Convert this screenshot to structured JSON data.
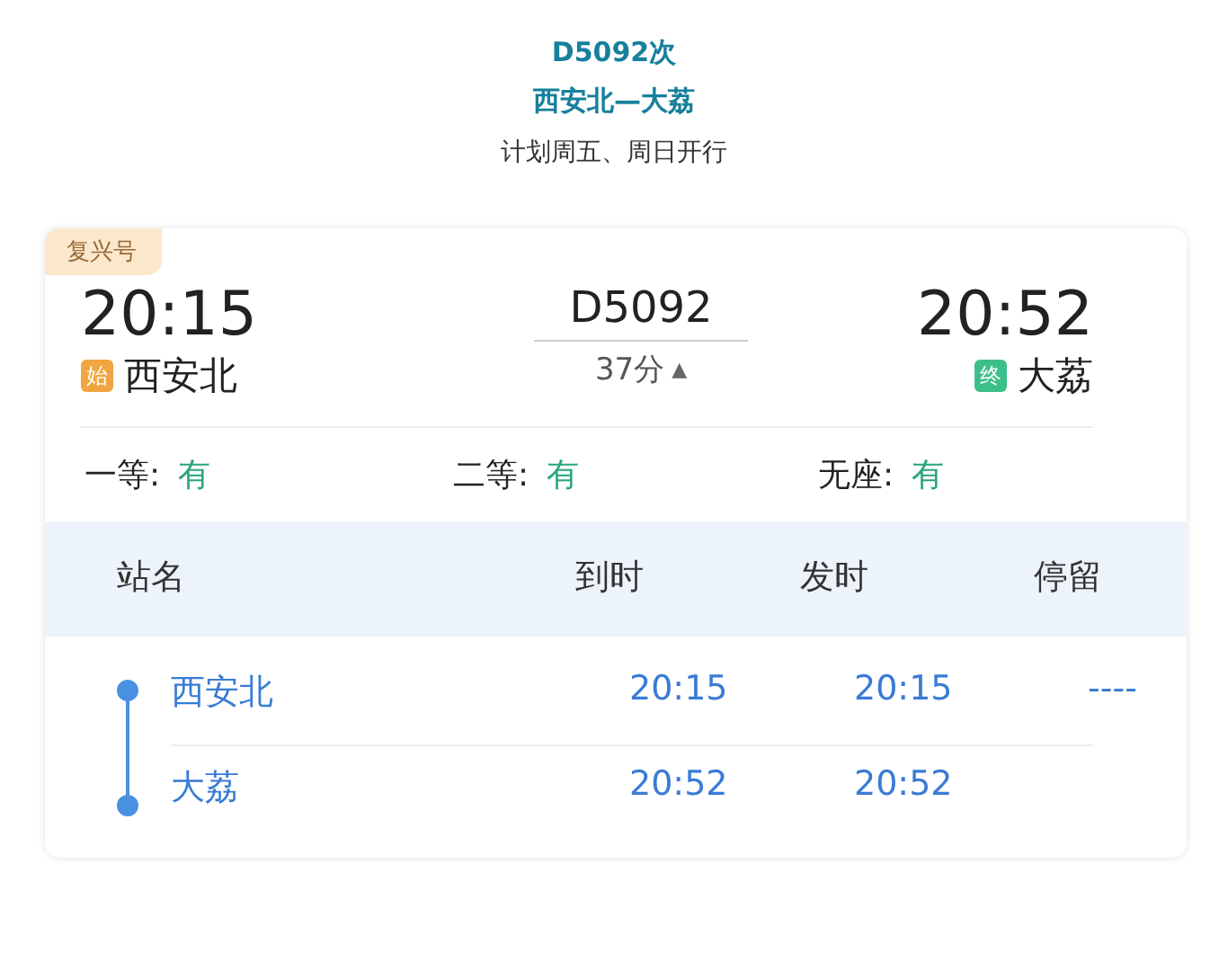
{
  "header": {
    "number": "D5092次",
    "route": "西安北—大荔",
    "schedule": "计划周五、周日开行"
  },
  "card": {
    "badge": "复兴号",
    "departure": {
      "time": "20:15",
      "marker": "始",
      "color": "#f0a640",
      "station": "西安北"
    },
    "train_code": "D5092",
    "duration": "37分",
    "toggle": "▲",
    "arrival": {
      "time": "20:52",
      "marker": "终",
      "color": "#3dbf8a",
      "station": "大荔"
    },
    "seats": [
      {
        "label": "一等:",
        "value": "有"
      },
      {
        "label": "二等:",
        "value": "有"
      },
      {
        "label": "无座:",
        "value": "有"
      }
    ],
    "stops_table": {
      "columns": [
        "站名",
        "到时",
        "发时",
        "停留"
      ],
      "rows": [
        {
          "station": "西安北",
          "arrive": "20:15",
          "depart": "20:15",
          "stop": "----"
        },
        {
          "station": "大荔",
          "arrive": "20:52",
          "depart": "20:52"
        }
      ]
    }
  }
}
